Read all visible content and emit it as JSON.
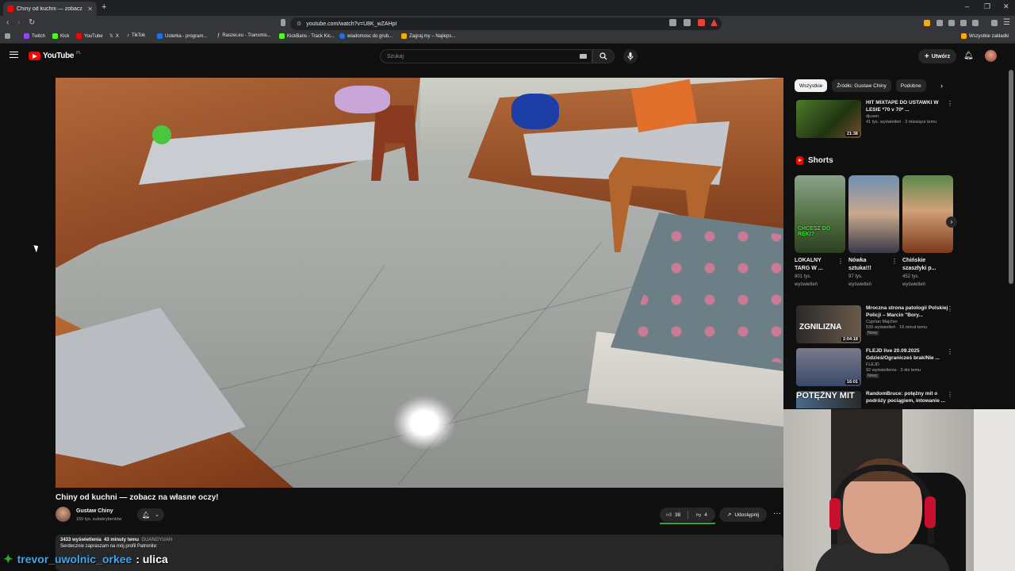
{
  "browser": {
    "tab_title": "Chiny od kuchni — zobacz na",
    "url": "youtube.com/watch?v=U8K_wZAHpI",
    "bookmarks": [
      {
        "label": "Twitch",
        "color": "#9146ff"
      },
      {
        "label": "Kick",
        "color": "#53fc18"
      },
      {
        "label": "YouTube",
        "color": "#ff0000"
      },
      {
        "label": "X",
        "color": "#e8eaed"
      },
      {
        "label": "TikTok",
        "color": "#e8eaed"
      },
      {
        "label": "Usterka - program...",
        "color": "#1a73e8"
      },
      {
        "label": "Raszei.eu - Transmis...",
        "color": "#e8eaed"
      },
      {
        "label": "KickBans - Track Kic...",
        "color": "#53fc18"
      },
      {
        "label": "wiadomosc do grub...",
        "color": "#1a73e8"
      },
      {
        "label": "Zagraj.my – Najleps...",
        "color": "#f9ab00"
      }
    ],
    "all_bookmarks": "Wszystkie zakładki"
  },
  "youtube": {
    "logo_text": "YouTube",
    "logo_country": "PL",
    "search_placeholder": "Szukaj",
    "create_label": "Utwórz"
  },
  "video": {
    "title": "Chiny od kuchni — zobacz na własne oczy!",
    "channel": "Gustaw Chiny",
    "subscribers": "155 tys. subskrybentów",
    "likes": "38",
    "dislikes": "4",
    "share_label": "Udostępnij",
    "views": "3433 wyświetlenia",
    "age": "43 minuty temu",
    "hashtag": "GUANGYUAN",
    "description": "Serdecznie zapraszam na mój profil Patronite:"
  },
  "chat": {
    "user": "trevor_uwolnic_orkee",
    "message": ": ulica"
  },
  "sidebar": {
    "chips": [
      "Wszystkie",
      "Źródło: Gustaw Chiny",
      "Podobne"
    ],
    "top_rec": {
      "title": "HIT MIXTAPE DO USTAWKI W LESIE *70 v 70* ...",
      "channel": "djusen",
      "meta": "41 tys. wyświetleń · 3 miesiące temu",
      "duration": "21:38"
    },
    "shorts_title": "Shorts",
    "shorts": [
      {
        "title": "LOKALNY TARG W ...",
        "views": "801 tys.",
        "views_label": "wyświetleń",
        "thumb_text": "CHCESZ DO RĘKI?"
      },
      {
        "title": "Nówka sztuka!!!",
        "views": "97 tys.",
        "views_label": "wyświetleń",
        "thumb_text": ""
      },
      {
        "title": "Chińskie szaszłyki p...",
        "views": "452 tys.",
        "views_label": "wyświetleń",
        "thumb_text": ""
      }
    ],
    "recs": [
      {
        "title": "Mroczna strona patologii Polskiej Policji – Marcin \"Bory...",
        "channel": "Cyprian Majcher",
        "meta": "539 wyświetleń · 16 minut temu",
        "badge": "Nowy",
        "duration": "2:04:18",
        "thumb_text": "ZGNILIZNA"
      },
      {
        "title": "FLEJD live 20.09.2025 Gdzieś/Ogranicześ brak/Nie ...",
        "channel": "FLEJD",
        "meta": "92 wyświetlenia · 3 dni temu",
        "badge": "Nowy",
        "duration": "16:01",
        "thumb_text": ""
      },
      {
        "title": "RandomBruce: potężny mit o podróży pociągiem, intowanie ...",
        "channel": "",
        "meta": "",
        "badge": "",
        "duration": "",
        "thumb_text": "POTĘŻNY MIT"
      }
    ]
  },
  "colors": {
    "accent": "#ff0000",
    "background": "#0f0f0f",
    "chat_user": "#3aa8f0"
  }
}
